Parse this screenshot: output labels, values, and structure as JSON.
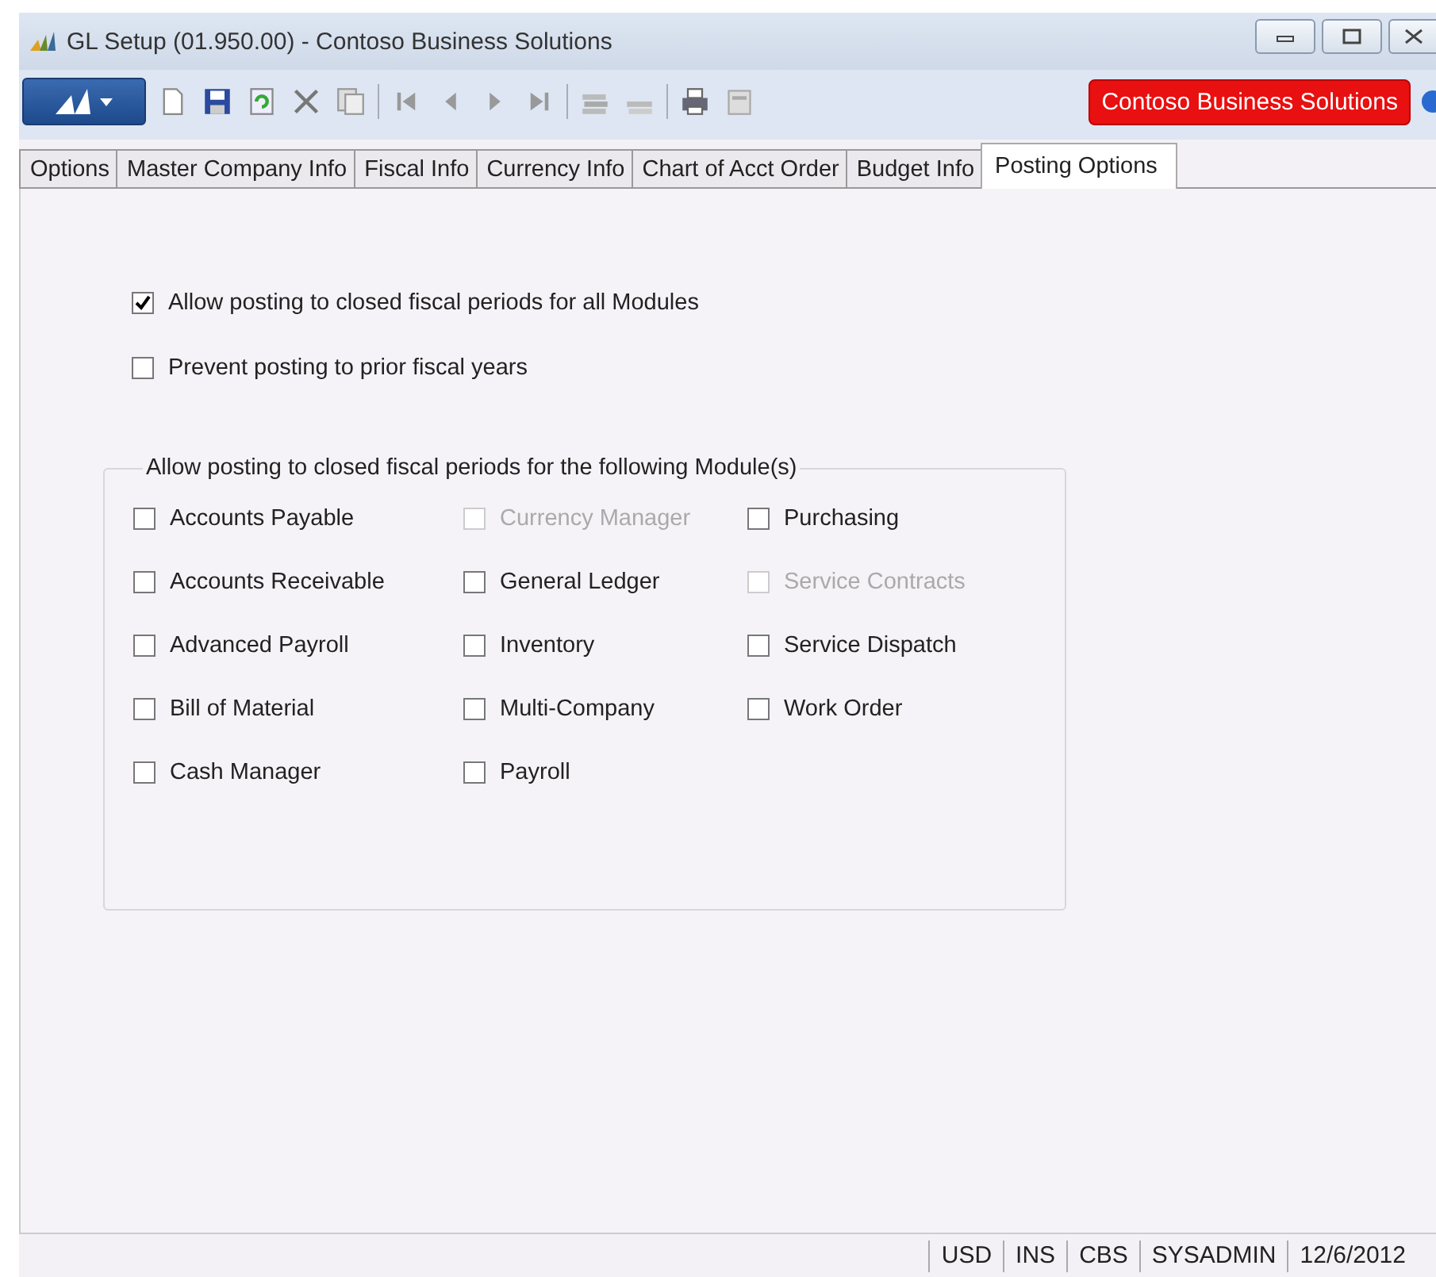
{
  "window": {
    "title": "GL Setup (01.950.00) - Contoso Business Solutions"
  },
  "toolbar": {
    "company_button": "Contoso Business Solutions"
  },
  "tabs": [
    {
      "label": "Options",
      "selected": false
    },
    {
      "label": "Master Company Info",
      "selected": false
    },
    {
      "label": "Fiscal Info",
      "selected": false
    },
    {
      "label": "Currency Info",
      "selected": false
    },
    {
      "label": "Chart of Acct Order",
      "selected": false
    },
    {
      "label": "Budget Info",
      "selected": false
    },
    {
      "label": "Posting Options",
      "selected": true
    }
  ],
  "options": [
    {
      "label": "Allow posting to closed fiscal periods for all Modules",
      "checked": true
    },
    {
      "label": "Prevent posting to prior fiscal years",
      "checked": false
    }
  ],
  "modules_group": {
    "title": "Allow posting to closed fiscal periods for the following Module(s)",
    "modules": [
      {
        "label": "Accounts Payable",
        "checked": false,
        "disabled": false
      },
      {
        "label": "Currency Manager",
        "checked": false,
        "disabled": true
      },
      {
        "label": "Purchasing",
        "checked": false,
        "disabled": false
      },
      {
        "label": "Accounts Receivable",
        "checked": false,
        "disabled": false
      },
      {
        "label": "General Ledger",
        "checked": false,
        "disabled": false
      },
      {
        "label": "Service Contracts",
        "checked": false,
        "disabled": true
      },
      {
        "label": "Advanced Payroll",
        "checked": false,
        "disabled": false
      },
      {
        "label": "Inventory",
        "checked": false,
        "disabled": false
      },
      {
        "label": "Service Dispatch",
        "checked": false,
        "disabled": false
      },
      {
        "label": "Bill of Material",
        "checked": false,
        "disabled": false
      },
      {
        "label": "Multi-Company",
        "checked": false,
        "disabled": false
      },
      {
        "label": "Work Order",
        "checked": false,
        "disabled": false
      },
      {
        "label": "Cash Manager",
        "checked": false,
        "disabled": false
      },
      {
        "label": "Payroll",
        "checked": false,
        "disabled": false
      }
    ]
  },
  "status_bar": [
    "USD",
    "INS",
    "CBS",
    "SYSADMIN",
    "12/6/2012"
  ]
}
